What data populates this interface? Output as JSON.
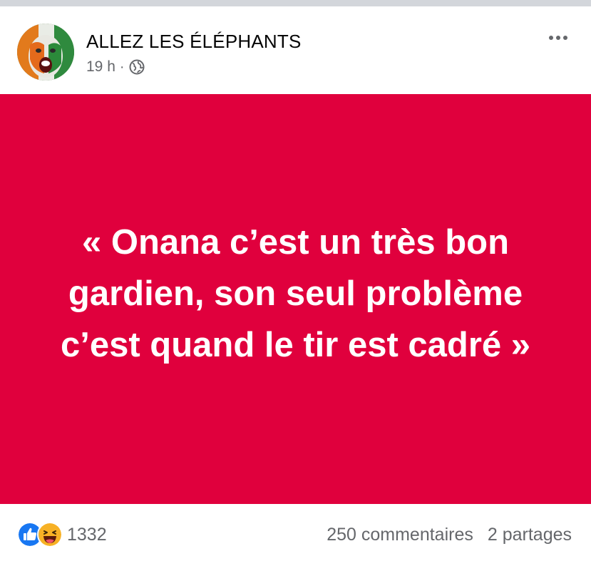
{
  "post": {
    "page_name": "ALLEZ LES ÉLÉPHANTS",
    "time": "19 h",
    "separator": "·",
    "audience_icon": "globe-icon",
    "more_icon": "more-horizontal-icon",
    "avatar": "avatar"
  },
  "card": {
    "background": "#e0003d",
    "text_color": "#ffffff",
    "text": "« Onana c’est un très bon gardien, son seul problème c’est quand le tir est cadré »"
  },
  "footer": {
    "reaction_icons": [
      "like-icon",
      "haha-icon"
    ],
    "reaction_count": "1332",
    "comments": "250 commentaires",
    "shares": "2 partages"
  },
  "colors": {
    "like_blue": "#1877f2",
    "haha_yellow": "#f7b125",
    "muted_text": "#65676b"
  }
}
